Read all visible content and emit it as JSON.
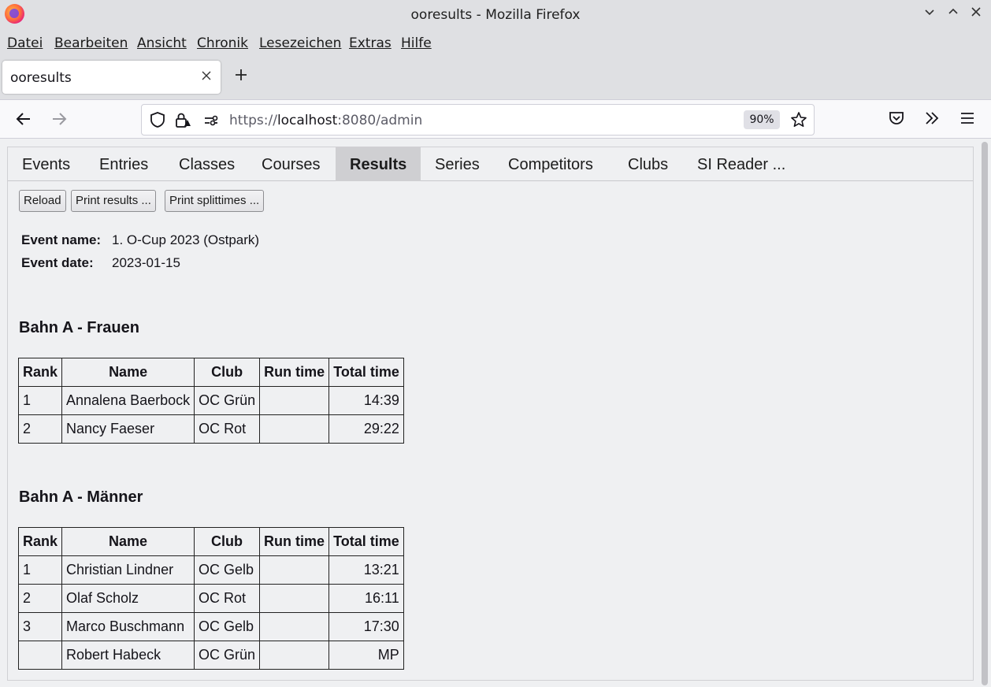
{
  "window": {
    "title": "ooresults - Mozilla Firefox"
  },
  "menu": {
    "items": [
      "Datei",
      "Bearbeiten",
      "Ansicht",
      "Chronik",
      "Lesezeichen",
      "Extras",
      "Hilfe"
    ]
  },
  "tab": {
    "title": "ooresults"
  },
  "urlbar": {
    "scheme": "https://",
    "host": "localhost",
    "rest": ":8080/admin",
    "zoom": "90%"
  },
  "app_tabs": [
    "Events",
    "Entries",
    "Classes",
    "Courses",
    "Results",
    "Series",
    "Competitors",
    "Clubs",
    "SI Reader ..."
  ],
  "active_tab": "Results",
  "toolbar": {
    "reload": "Reload",
    "print_results": "Print results ...",
    "print_splittimes": "Print splittimes ..."
  },
  "event": {
    "name_label": "Event name:",
    "name": "1. O-Cup 2023 (Ostpark)",
    "date_label": "Event date:",
    "date": "2023-01-15"
  },
  "columns": [
    "Rank",
    "Name",
    "Club",
    "Run time",
    "Total time"
  ],
  "groups": [
    {
      "title": "Bahn A - Frauen",
      "rows": [
        {
          "rank": "1",
          "name": "Annalena Baerbock",
          "club": "OC Grün",
          "run_time": "",
          "total_time": "14:39"
        },
        {
          "rank": "2",
          "name": "Nancy Faeser",
          "club": "OC Rot",
          "run_time": "",
          "total_time": "29:22"
        }
      ]
    },
    {
      "title": "Bahn A - Männer",
      "rows": [
        {
          "rank": "1",
          "name": "Christian Lindner",
          "club": "OC Gelb",
          "run_time": "",
          "total_time": "13:21"
        },
        {
          "rank": "2",
          "name": "Olaf Scholz",
          "club": "OC Rot",
          "run_time": "",
          "total_time": "16:11"
        },
        {
          "rank": "3",
          "name": "Marco Buschmann",
          "club": "OC Gelb",
          "run_time": "",
          "total_time": "17:30"
        },
        {
          "rank": "",
          "name": "Robert Habeck",
          "club": "OC Grün",
          "run_time": "",
          "total_time": "MP"
        }
      ]
    }
  ]
}
